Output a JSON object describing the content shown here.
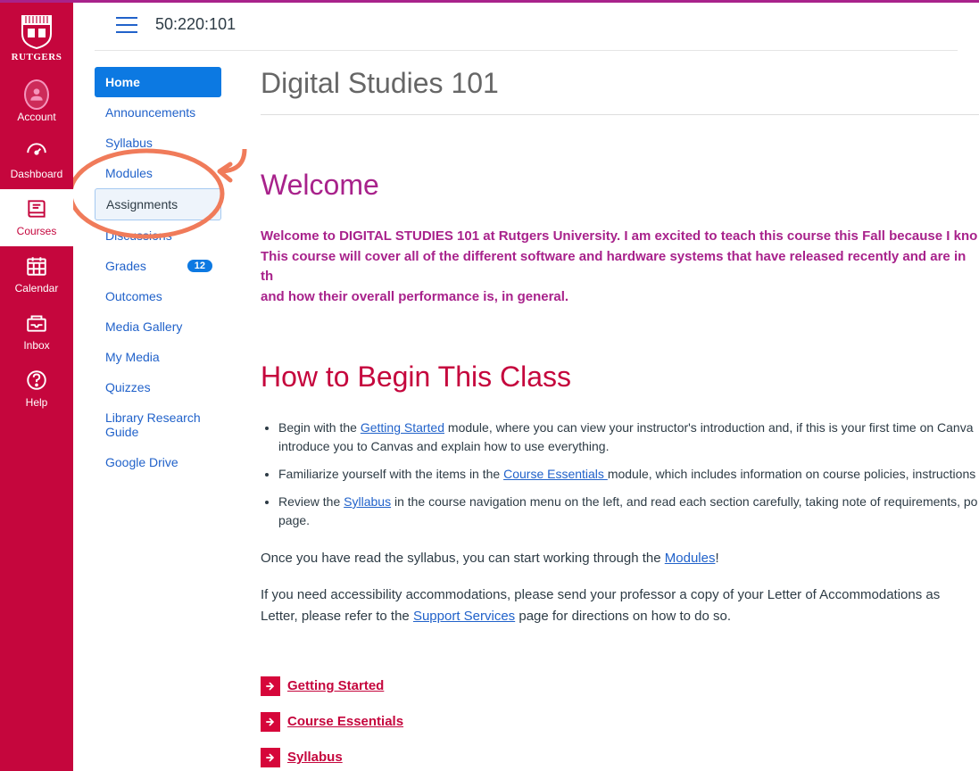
{
  "globalNav": {
    "brand": "RUTGERS",
    "items": [
      {
        "label": "Account",
        "icon": "avatar"
      },
      {
        "label": "Dashboard",
        "icon": "dashboard"
      },
      {
        "label": "Courses",
        "icon": "courses",
        "active": true
      },
      {
        "label": "Calendar",
        "icon": "calendar"
      },
      {
        "label": "Inbox",
        "icon": "inbox"
      },
      {
        "label": "Help",
        "icon": "help"
      }
    ]
  },
  "breadcrumb": "50:220:101",
  "courseNav": {
    "items": [
      {
        "label": "Home",
        "active": true
      },
      {
        "label": "Announcements"
      },
      {
        "label": "Syllabus"
      },
      {
        "label": "Modules"
      },
      {
        "label": "Assignments",
        "highlighted": true
      },
      {
        "label": "Discussions"
      },
      {
        "label": "Grades",
        "badge": "12"
      },
      {
        "label": "Outcomes"
      },
      {
        "label": "Media Gallery"
      },
      {
        "label": "My Media"
      },
      {
        "label": "Quizzes"
      },
      {
        "label": "Library Research Guide"
      },
      {
        "label": "Google Drive"
      }
    ]
  },
  "page": {
    "title": "Digital Studies 101",
    "welcome": {
      "heading": "Welcome",
      "para_line1": "Welcome to DIGITAL STUDIES 101 at Rutgers University. I am excited to teach this course this Fall because I kno",
      "para_line2": "This course will cover all of the different software and hardware systems that have released recently and are in th",
      "para_line3": "and how their overall performance is, in general."
    },
    "begin": {
      "heading": "How to Begin This Class",
      "bullets": [
        {
          "pre": "Begin with the ",
          "link": "Getting Started",
          "post": " module, where you can view your instructor's introduction and, if this is your first time on Canva",
          "cont": "introduce you to Canvas and explain how to use everything."
        },
        {
          "pre": "Familiarize yourself with the items in the ",
          "link": "Course Essentials ",
          "post": "module, which includes information on course policies, instructions"
        },
        {
          "pre": "Review the ",
          "link": "Syllabus",
          "post": " in the course navigation menu on the left, and read each section carefully, taking note of requirements, po",
          "cont": "page."
        }
      ],
      "para1_pre": "Once you have read the syllabus, you can start working through the ",
      "para1_link": "Modules",
      "para1_post": "!",
      "para2_pre": "If you need accessibility accommodations, please send your professor a copy of your Letter of Accommodations as ",
      "para2_cont_pre": "Letter, please refer to the ",
      "para2_cont_link": "Support Services",
      "para2_cont_post": " page for directions on how to do so."
    },
    "quickLinks": [
      "Getting Started",
      "Course Essentials",
      "Syllabus"
    ]
  },
  "colors": {
    "rutgersRed": "#c5063d",
    "magenta": "#a8228b",
    "link": "#2162ca",
    "annotation": "#f07b5a"
  }
}
